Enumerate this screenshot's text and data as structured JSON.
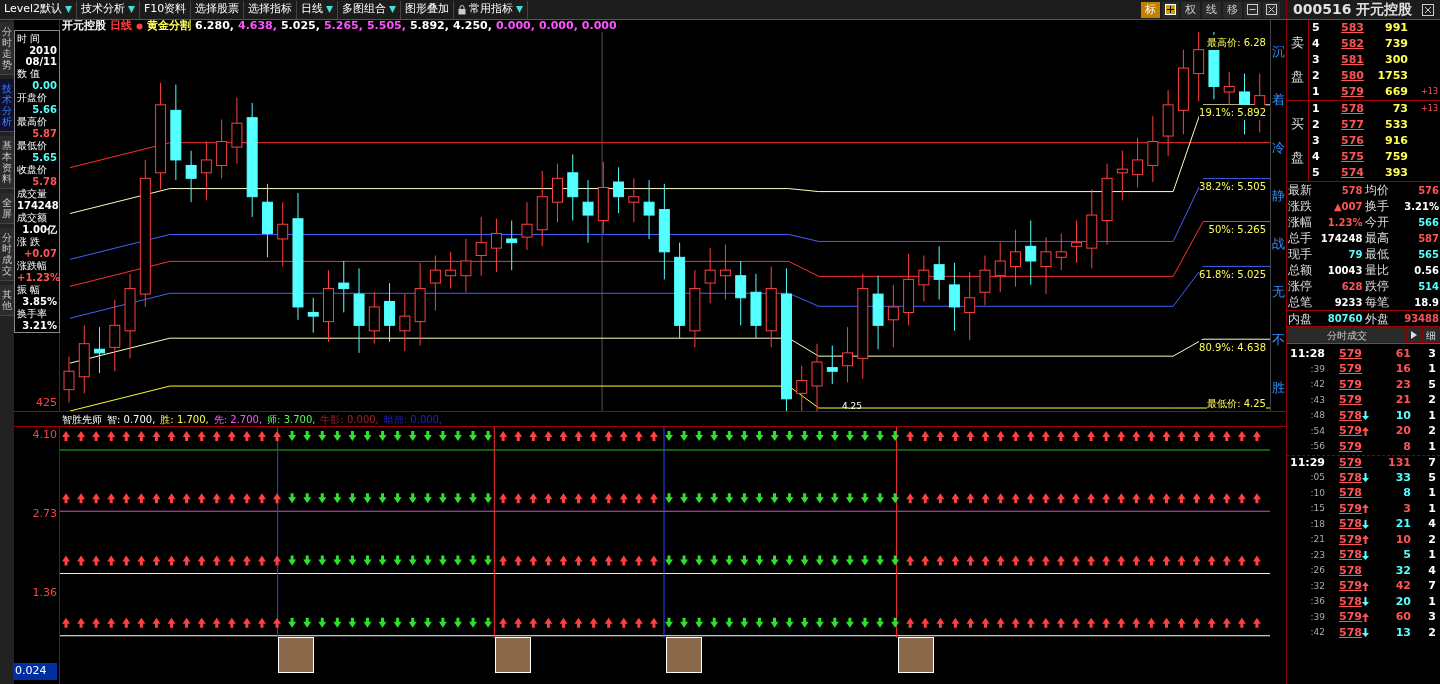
{
  "toolbar": {
    "items": [
      {
        "label": "Level2默认",
        "dropdown": true
      },
      {
        "label": "技术分析",
        "dropdown": true
      },
      {
        "label": "F10资料",
        "dropdown": false
      },
      {
        "label": "选择股票",
        "dropdown": false
      },
      {
        "label": "选择指标",
        "dropdown": false
      },
      {
        "label": "日线",
        "dropdown": true
      },
      {
        "label": "多图组合",
        "dropdown": true
      },
      {
        "label": "图形叠加",
        "dropdown": false
      },
      {
        "label": "常用指标",
        "dropdown": true
      }
    ],
    "tools": [
      {
        "kind": "text",
        "label": "标",
        "selected": true
      },
      {
        "kind": "plus",
        "selected": false
      },
      {
        "kind": "text",
        "label": "权",
        "selected": false
      },
      {
        "kind": "text",
        "label": "线",
        "selected": false
      },
      {
        "kind": "text",
        "label": "移",
        "selected": false
      },
      {
        "kind": "minus",
        "selected": false
      },
      {
        "kind": "close",
        "selected": false
      }
    ]
  },
  "left_tabs": [
    {
      "label": "分时走势",
      "selected": false
    },
    {
      "label": "技术分析",
      "selected": true
    },
    {
      "label": "基本资料",
      "selected": false
    },
    {
      "label": "全屏",
      "selected": false
    },
    {
      "label": "分时成交",
      "selected": false
    },
    {
      "label": "其他",
      "selected": false
    }
  ],
  "chart_header": {
    "stock": "开元控股",
    "period": "日线",
    "indicator": "黄金分割",
    "values": [
      {
        "text": "6.280,",
        "color": "#ffffff"
      },
      {
        "text": "4.638,",
        "color": "#ff54ff"
      },
      {
        "text": "5.025,",
        "color": "#ffffff"
      },
      {
        "text": "5.265,",
        "color": "#ff54ff"
      },
      {
        "text": "5.505,",
        "color": "#ff54ff"
      },
      {
        "text": "5.892,",
        "color": "#ffffff"
      },
      {
        "text": "4.250,",
        "color": "#ffffff"
      },
      {
        "text": "0.000,",
        "color": "#ff54ff"
      },
      {
        "text": "0.000,",
        "color": "#ff54ff"
      },
      {
        "text": "0.000",
        "color": "#ff54ff"
      }
    ]
  },
  "info_box": [
    {
      "label": "时 间",
      "lines": [
        "2010",
        "08/11"
      ],
      "color": "#ffffff"
    },
    {
      "label": "数 值",
      "lines": [
        "0.00"
      ],
      "color": "#54ffff"
    },
    {
      "label": "开盘价",
      "lines": [
        "5.66"
      ],
      "color": "#54ffff"
    },
    {
      "label": "最高价",
      "lines": [
        "5.87"
      ],
      "color": "#ff5454"
    },
    {
      "label": "最低价",
      "lines": [
        "5.65"
      ],
      "color": "#54ffff"
    },
    {
      "label": "收盘价",
      "lines": [
        "5.78"
      ],
      "color": "#ff5454"
    },
    {
      "label": "成交量",
      "lines": [
        "174248"
      ],
      "color": "#ffffff"
    },
    {
      "label": "成交额",
      "lines": [
        "1.00亿"
      ],
      "color": "#ffffff"
    },
    {
      "label": "涨 跌",
      "lines": [
        "+0.07"
      ],
      "color": "#ff5454"
    },
    {
      "label": "涨跌幅",
      "lines": [
        "+1.23%"
      ],
      "color": "#ff5454"
    },
    {
      "label": "振 幅",
      "lines": [
        "3.85%"
      ],
      "color": "#ffffff"
    },
    {
      "label": "换手率",
      "lines": [
        "3.21%"
      ],
      "color": "#ffffff"
    }
  ],
  "fib_labels": [
    "最高价: 6.28",
    "19.1%: 5.892",
    "38.2%: 5.505",
    "50%: 5.265",
    "61.8%: 5.025",
    "80.9%: 4.638",
    "最低价: 4.25"
  ],
  "low_marker": "4.25",
  "price_axis": [
    "425"
  ],
  "side_motto": "沉着冷静战无不胜",
  "indicator": {
    "title": "智胜先师",
    "items": [
      {
        "text": "智: 0.700,",
        "color": "#ffffff"
      },
      {
        "text": "胜: 1.700,",
        "color": "#ffff54"
      },
      {
        "text": "先: 2.700,",
        "color": "#ff54ff"
      },
      {
        "text": "师: 3.700,",
        "color": "#54ff54"
      },
      {
        "text": "牛影: 0.000,",
        "color": "#a02020"
      },
      {
        "text": "暗箭: 0.000,",
        "color": "#2020c0"
      }
    ],
    "axis": [
      "4.10",
      "2.73",
      "1.36",
      "0.024"
    ]
  },
  "quote": {
    "code": "000516",
    "name": "开元控股",
    "sell_label": [
      "卖",
      "盘"
    ],
    "buy_label": [
      "买",
      "盘"
    ],
    "sell": [
      {
        "level": "5",
        "price": "583",
        "volume": "991"
      },
      {
        "level": "4",
        "price": "582",
        "volume": "739"
      },
      {
        "level": "3",
        "price": "581",
        "volume": "300"
      },
      {
        "level": "2",
        "price": "580",
        "volume": "1753"
      },
      {
        "level": "1",
        "price": "579",
        "volume": "669",
        "change": "+13"
      }
    ],
    "buy": [
      {
        "level": "1",
        "price": "578",
        "volume": "73",
        "change": "+13"
      },
      {
        "level": "2",
        "price": "577",
        "volume": "533"
      },
      {
        "level": "3",
        "price": "576",
        "volume": "916"
      },
      {
        "level": "4",
        "price": "575",
        "volume": "759"
      },
      {
        "level": "5",
        "price": "574",
        "volume": "393"
      }
    ],
    "stats": [
      {
        "label": "最新",
        "value": "578",
        "color": "#ff5454"
      },
      {
        "label": "均价",
        "value": "576",
        "color": "#ff5454"
      },
      {
        "label": "涨跌",
        "value": "▲007",
        "color": "#ff5454"
      },
      {
        "label": "换手",
        "value": "3.21%",
        "color": "#ffffff"
      },
      {
        "label": "涨幅",
        "value": "1.23%",
        "color": "#ff5454"
      },
      {
        "label": "今开",
        "value": "566",
        "color": "#54ffff"
      },
      {
        "label": "总手",
        "value": "174248",
        "color": "#ffffff"
      },
      {
        "label": "最高",
        "value": "587",
        "color": "#ff5454"
      },
      {
        "label": "现手",
        "value": "79",
        "color": "#54ffff"
      },
      {
        "label": "最低",
        "value": "565",
        "color": "#54ffff"
      },
      {
        "label": "总额",
        "value": "10043",
        "color": "#ffffff"
      },
      {
        "label": "量比",
        "value": "0.56",
        "color": "#ffffff"
      },
      {
        "label": "涨停",
        "value": "628",
        "color": "#ff5454"
      },
      {
        "label": "跌停",
        "value": "514",
        "color": "#54ffff"
      },
      {
        "label": "总笔",
        "value": "9233",
        "color": "#ffffff"
      },
      {
        "label": "每笔",
        "value": "18.9",
        "color": "#ffffff"
      },
      {
        "label": "内盘",
        "value": "80760",
        "color": "#54ffff"
      },
      {
        "label": "外盘",
        "value": "93488",
        "color": "#ff5454"
      }
    ],
    "trades_tab": "分时成交",
    "detail_button": "细",
    "trades": [
      {
        "kind": "minute",
        "time": "11:28",
        "price": "579",
        "up": false,
        "down": false,
        "volume": "61",
        "sell": false,
        "count": "3"
      },
      {
        "kind": "tick",
        "time": ":39",
        "price": "579",
        "up": false,
        "down": false,
        "volume": "16",
        "sell": false,
        "count": "1"
      },
      {
        "kind": "tick",
        "time": ":42",
        "price": "579",
        "up": false,
        "down": false,
        "volume": "23",
        "sell": false,
        "count": "5"
      },
      {
        "kind": "tick",
        "time": ":43",
        "price": "579",
        "up": false,
        "down": false,
        "volume": "21",
        "sell": false,
        "count": "2"
      },
      {
        "kind": "tick",
        "time": ":48",
        "price": "578",
        "up": false,
        "down": true,
        "volume": "10",
        "sell": true,
        "count": "1"
      },
      {
        "kind": "tick",
        "time": ":54",
        "price": "579",
        "up": true,
        "down": false,
        "volume": "20",
        "sell": false,
        "count": "2"
      },
      {
        "kind": "tick",
        "time": ":56",
        "price": "579",
        "up": false,
        "down": false,
        "volume": "8",
        "sell": false,
        "count": "1"
      },
      {
        "kind": "minute",
        "time": "11:29",
        "price": "579",
        "up": false,
        "down": false,
        "volume": "131",
        "sell": false,
        "count": "7"
      },
      {
        "kind": "tick",
        "time": ":05",
        "price": "578",
        "up": false,
        "down": true,
        "volume": "33",
        "sell": true,
        "count": "5"
      },
      {
        "kind": "tick",
        "time": ":10",
        "price": "578",
        "up": false,
        "down": false,
        "volume": "8",
        "sell": true,
        "count": "1"
      },
      {
        "kind": "tick",
        "time": ":15",
        "price": "579",
        "up": true,
        "down": false,
        "volume": "3",
        "sell": false,
        "count": "1"
      },
      {
        "kind": "tick",
        "time": ":18",
        "price": "578",
        "up": false,
        "down": true,
        "volume": "21",
        "sell": true,
        "count": "4"
      },
      {
        "kind": "tick",
        "time": ":21",
        "price": "579",
        "up": true,
        "down": false,
        "volume": "10",
        "sell": false,
        "count": "2"
      },
      {
        "kind": "tick",
        "time": ":23",
        "price": "578",
        "up": false,
        "down": true,
        "volume": "5",
        "sell": true,
        "count": "1"
      },
      {
        "kind": "tick",
        "time": ":26",
        "price": "578",
        "up": false,
        "down": false,
        "volume": "32",
        "sell": true,
        "count": "4"
      },
      {
        "kind": "tick",
        "time": ":32",
        "price": "579",
        "up": true,
        "down": false,
        "volume": "42",
        "sell": false,
        "count": "7"
      },
      {
        "kind": "tick",
        "time": ":36",
        "price": "578",
        "up": false,
        "down": true,
        "volume": "20",
        "sell": true,
        "count": "1"
      },
      {
        "kind": "tick",
        "time": ":39",
        "price": "579",
        "up": true,
        "down": false,
        "volume": "60",
        "sell": false,
        "count": "3"
      },
      {
        "kind": "tick",
        "time": ":42",
        "price": "578",
        "up": false,
        "down": true,
        "volume": "13",
        "sell": true,
        "count": "2"
      }
    ]
  }
}
